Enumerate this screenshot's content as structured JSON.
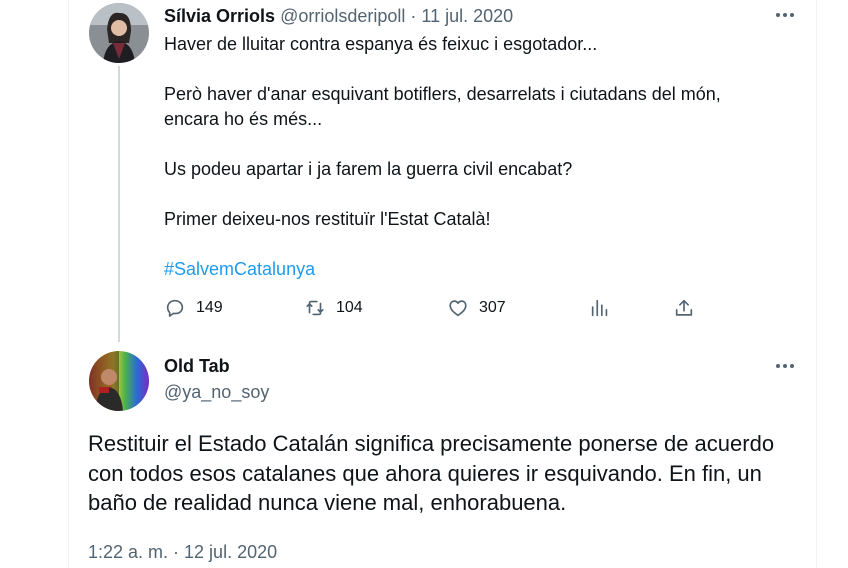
{
  "original_tweet": {
    "author_name": "Sílvia Orriols",
    "author_handle": "@orriolsderipoll",
    "separator": " · ",
    "date": "11 jul. 2020",
    "paragraphs": [
      [
        "Haver de lluitar contra espanya és feixuc i esgotador..."
      ],
      [
        "Però haver d'anar esquivant botiflers, desarrelats i ciutadans del món,",
        "encara ho és més..."
      ],
      [
        "Us podeu apartar i ja farem la guerra civil encabat?"
      ],
      [
        "Primer deixeu-nos restituïr l'Estat Català!"
      ]
    ],
    "hashtag": "#SalvemCatalunya",
    "actions": {
      "reply_count": "149",
      "retweet_count": "104",
      "like_count": "307"
    },
    "more_icon": "more-dots-icon"
  },
  "reply_tweet": {
    "author_name": "Old Tab",
    "author_handle": "@ya_no_soy",
    "lines": [
      "Restituir el Estado Catalán significa precisamente ponerse de acuerdo",
      "con todos esos catalanes que ahora quieres ir esquivando. En fin, un",
      "baño de realidad nunca viene mal, enhorabuena."
    ],
    "timestamp": "1:22 a. m. · 12 jul. 2020",
    "more_icon": "more-dots-icon"
  },
  "colors": {
    "text": "#0f1419",
    "muted": "#536471",
    "link": "#1d9bf0",
    "thread_line": "#cfd9de"
  }
}
